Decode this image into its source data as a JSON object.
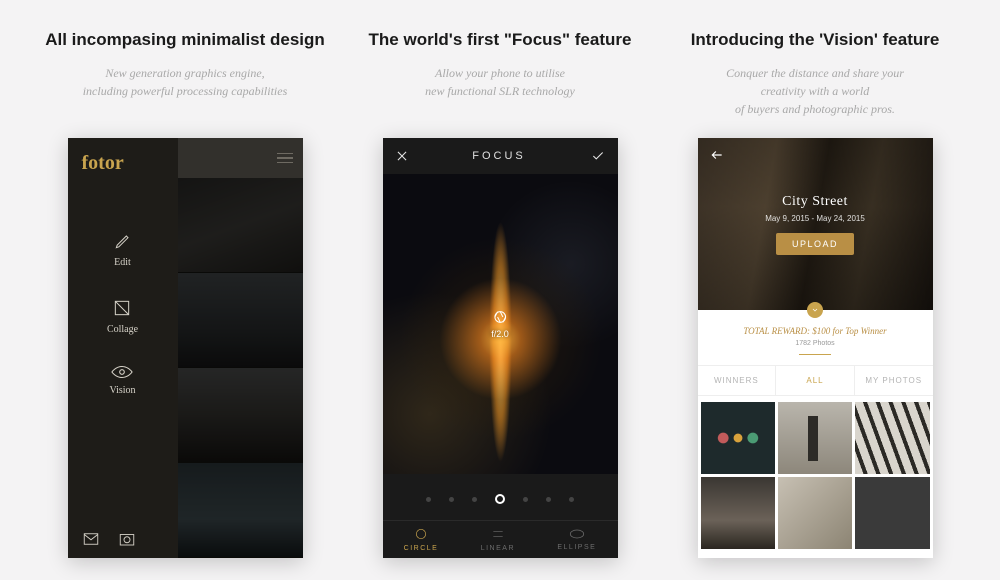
{
  "panels": [
    {
      "title": "All incompasing minimalist design",
      "sub1": "New generation graphics engine,",
      "sub2": "including powerful processing capabilities"
    },
    {
      "title": "The world's first \"Focus\" feature",
      "sub1": "Allow your phone to utilise",
      "sub2": "new functional SLR technology"
    },
    {
      "title": "Introducing the 'Vision' feature",
      "sub1": "Conquer the distance and share your",
      "sub2": "creativity with a world",
      "sub3": "of buyers and photographic pros."
    }
  ],
  "phone1": {
    "logo": "fotor",
    "nav": [
      "Edit",
      "Collage",
      "Vision"
    ]
  },
  "phone2": {
    "header": "FOCUS",
    "aperture": "f/2.0",
    "modes": [
      "CIRCLE",
      "LINEAR",
      "ELLIPSE"
    ]
  },
  "phone3": {
    "hero_title": "City Street",
    "hero_dates": "May 9, 2015 - May 24, 2015",
    "upload": "UPLOAD",
    "reward": "TOTAL REWARD: $100 for Top Winner",
    "count": "1782 Photos",
    "tabs": [
      "WINNERS",
      "ALL",
      "MY PHOTOS"
    ]
  }
}
